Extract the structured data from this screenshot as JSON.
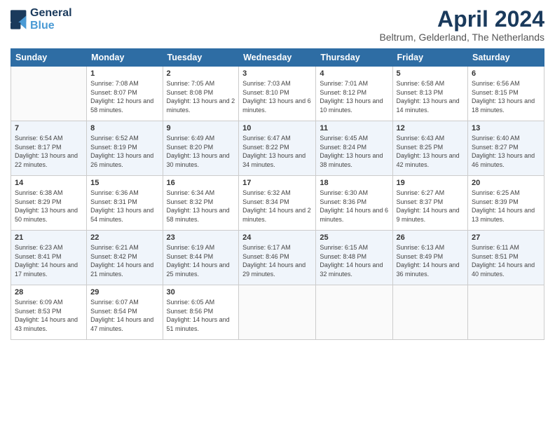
{
  "header": {
    "logo_line1": "General",
    "logo_line2": "Blue",
    "title": "April 2024",
    "subtitle": "Beltrum, Gelderland, The Netherlands"
  },
  "days": [
    "Sunday",
    "Monday",
    "Tuesday",
    "Wednesday",
    "Thursday",
    "Friday",
    "Saturday"
  ],
  "weeks": [
    [
      {
        "day": "",
        "sunrise": "",
        "sunset": "",
        "daylight": ""
      },
      {
        "day": "1",
        "sunrise": "Sunrise: 7:08 AM",
        "sunset": "Sunset: 8:07 PM",
        "daylight": "Daylight: 12 hours and 58 minutes."
      },
      {
        "day": "2",
        "sunrise": "Sunrise: 7:05 AM",
        "sunset": "Sunset: 8:08 PM",
        "daylight": "Daylight: 13 hours and 2 minutes."
      },
      {
        "day": "3",
        "sunrise": "Sunrise: 7:03 AM",
        "sunset": "Sunset: 8:10 PM",
        "daylight": "Daylight: 13 hours and 6 minutes."
      },
      {
        "day": "4",
        "sunrise": "Sunrise: 7:01 AM",
        "sunset": "Sunset: 8:12 PM",
        "daylight": "Daylight: 13 hours and 10 minutes."
      },
      {
        "day": "5",
        "sunrise": "Sunrise: 6:58 AM",
        "sunset": "Sunset: 8:13 PM",
        "daylight": "Daylight: 13 hours and 14 minutes."
      },
      {
        "day": "6",
        "sunrise": "Sunrise: 6:56 AM",
        "sunset": "Sunset: 8:15 PM",
        "daylight": "Daylight: 13 hours and 18 minutes."
      }
    ],
    [
      {
        "day": "7",
        "sunrise": "Sunrise: 6:54 AM",
        "sunset": "Sunset: 8:17 PM",
        "daylight": "Daylight: 13 hours and 22 minutes."
      },
      {
        "day": "8",
        "sunrise": "Sunrise: 6:52 AM",
        "sunset": "Sunset: 8:19 PM",
        "daylight": "Daylight: 13 hours and 26 minutes."
      },
      {
        "day": "9",
        "sunrise": "Sunrise: 6:49 AM",
        "sunset": "Sunset: 8:20 PM",
        "daylight": "Daylight: 13 hours and 30 minutes."
      },
      {
        "day": "10",
        "sunrise": "Sunrise: 6:47 AM",
        "sunset": "Sunset: 8:22 PM",
        "daylight": "Daylight: 13 hours and 34 minutes."
      },
      {
        "day": "11",
        "sunrise": "Sunrise: 6:45 AM",
        "sunset": "Sunset: 8:24 PM",
        "daylight": "Daylight: 13 hours and 38 minutes."
      },
      {
        "day": "12",
        "sunrise": "Sunrise: 6:43 AM",
        "sunset": "Sunset: 8:25 PM",
        "daylight": "Daylight: 13 hours and 42 minutes."
      },
      {
        "day": "13",
        "sunrise": "Sunrise: 6:40 AM",
        "sunset": "Sunset: 8:27 PM",
        "daylight": "Daylight: 13 hours and 46 minutes."
      }
    ],
    [
      {
        "day": "14",
        "sunrise": "Sunrise: 6:38 AM",
        "sunset": "Sunset: 8:29 PM",
        "daylight": "Daylight: 13 hours and 50 minutes."
      },
      {
        "day": "15",
        "sunrise": "Sunrise: 6:36 AM",
        "sunset": "Sunset: 8:31 PM",
        "daylight": "Daylight: 13 hours and 54 minutes."
      },
      {
        "day": "16",
        "sunrise": "Sunrise: 6:34 AM",
        "sunset": "Sunset: 8:32 PM",
        "daylight": "Daylight: 13 hours and 58 minutes."
      },
      {
        "day": "17",
        "sunrise": "Sunrise: 6:32 AM",
        "sunset": "Sunset: 8:34 PM",
        "daylight": "Daylight: 14 hours and 2 minutes."
      },
      {
        "day": "18",
        "sunrise": "Sunrise: 6:30 AM",
        "sunset": "Sunset: 8:36 PM",
        "daylight": "Daylight: 14 hours and 6 minutes."
      },
      {
        "day": "19",
        "sunrise": "Sunrise: 6:27 AM",
        "sunset": "Sunset: 8:37 PM",
        "daylight": "Daylight: 14 hours and 9 minutes."
      },
      {
        "day": "20",
        "sunrise": "Sunrise: 6:25 AM",
        "sunset": "Sunset: 8:39 PM",
        "daylight": "Daylight: 14 hours and 13 minutes."
      }
    ],
    [
      {
        "day": "21",
        "sunrise": "Sunrise: 6:23 AM",
        "sunset": "Sunset: 8:41 PM",
        "daylight": "Daylight: 14 hours and 17 minutes."
      },
      {
        "day": "22",
        "sunrise": "Sunrise: 6:21 AM",
        "sunset": "Sunset: 8:42 PM",
        "daylight": "Daylight: 14 hours and 21 minutes."
      },
      {
        "day": "23",
        "sunrise": "Sunrise: 6:19 AM",
        "sunset": "Sunset: 8:44 PM",
        "daylight": "Daylight: 14 hours and 25 minutes."
      },
      {
        "day": "24",
        "sunrise": "Sunrise: 6:17 AM",
        "sunset": "Sunset: 8:46 PM",
        "daylight": "Daylight: 14 hours and 29 minutes."
      },
      {
        "day": "25",
        "sunrise": "Sunrise: 6:15 AM",
        "sunset": "Sunset: 8:48 PM",
        "daylight": "Daylight: 14 hours and 32 minutes."
      },
      {
        "day": "26",
        "sunrise": "Sunrise: 6:13 AM",
        "sunset": "Sunset: 8:49 PM",
        "daylight": "Daylight: 14 hours and 36 minutes."
      },
      {
        "day": "27",
        "sunrise": "Sunrise: 6:11 AM",
        "sunset": "Sunset: 8:51 PM",
        "daylight": "Daylight: 14 hours and 40 minutes."
      }
    ],
    [
      {
        "day": "28",
        "sunrise": "Sunrise: 6:09 AM",
        "sunset": "Sunset: 8:53 PM",
        "daylight": "Daylight: 14 hours and 43 minutes."
      },
      {
        "day": "29",
        "sunrise": "Sunrise: 6:07 AM",
        "sunset": "Sunset: 8:54 PM",
        "daylight": "Daylight: 14 hours and 47 minutes."
      },
      {
        "day": "30",
        "sunrise": "Sunrise: 6:05 AM",
        "sunset": "Sunset: 8:56 PM",
        "daylight": "Daylight: 14 hours and 51 minutes."
      },
      {
        "day": "",
        "sunrise": "",
        "sunset": "",
        "daylight": ""
      },
      {
        "day": "",
        "sunrise": "",
        "sunset": "",
        "daylight": ""
      },
      {
        "day": "",
        "sunrise": "",
        "sunset": "",
        "daylight": ""
      },
      {
        "day": "",
        "sunrise": "",
        "sunset": "",
        "daylight": ""
      }
    ]
  ]
}
